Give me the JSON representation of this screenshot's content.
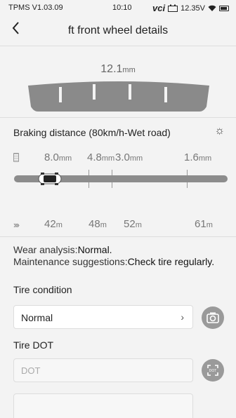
{
  "status_bar": {
    "app_version": "TPMS V1.03.09",
    "time": "10:10",
    "vci": "vci",
    "voltage": "12.35V"
  },
  "header": {
    "title": "ft front wheel details",
    "back_icon": "chevron-left-icon"
  },
  "tread": {
    "value": "12.1",
    "unit": "mm"
  },
  "braking": {
    "title": "Braking distance (80km/h-Wet road)",
    "depths": [
      {
        "value": "8.0",
        "unit": "mm"
      },
      {
        "value": "4.8",
        "unit": "mm"
      },
      {
        "value": "3.0",
        "unit": "mm"
      },
      {
        "value": "1.6",
        "unit": "mm"
      }
    ],
    "distances": [
      {
        "value": "42",
        "unit": "m"
      },
      {
        "value": "48",
        "unit": "m"
      },
      {
        "value": "52",
        "unit": "m"
      },
      {
        "value": "61",
        "unit": "m"
      }
    ]
  },
  "wear": {
    "analysis_label": "Wear analysis:",
    "analysis_value": "Normal.",
    "suggestion_label": "Maintenance suggestions:",
    "suggestion_value": "Check tire regularly."
  },
  "tire_condition": {
    "label": "Tire condition",
    "value": "Normal"
  },
  "tire_dot": {
    "label": "Tire DOT",
    "placeholder": "DOT",
    "scan_text": "DOT"
  }
}
